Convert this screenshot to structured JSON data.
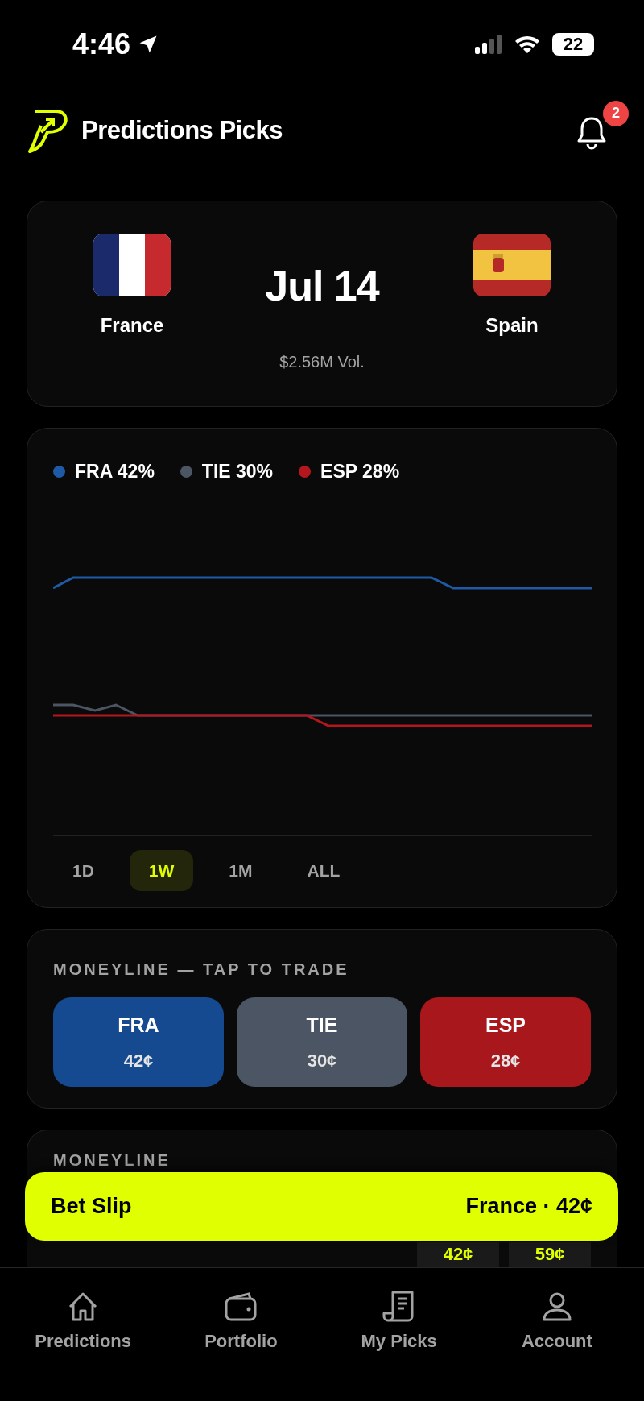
{
  "status_bar": {
    "time": "4:46",
    "battery": "22"
  },
  "header": {
    "title": "Predictions Picks",
    "notification_count": "2"
  },
  "match": {
    "date": "Jul 14",
    "volume": "$2.56M Vol.",
    "teams": [
      {
        "name": "France",
        "kind": "france"
      },
      {
        "name": "Spain",
        "kind": "spain"
      }
    ]
  },
  "chart": {
    "legend": [
      {
        "label": "FRA 42%",
        "color": "#1f5aa6"
      },
      {
        "label": "TIE 30%",
        "color": "#4b5563"
      },
      {
        "label": "ESP 28%",
        "color": "#b3161d"
      }
    ],
    "ranges": [
      {
        "label": "1D",
        "selected": false
      },
      {
        "label": "1W",
        "selected": true
      },
      {
        "label": "1M",
        "selected": false
      },
      {
        "label": "ALL",
        "selected": false
      }
    ]
  },
  "moneyline": {
    "title": "MONEYLINE — TAP TO TRADE",
    "options": [
      {
        "code": "FRA",
        "price": "42¢",
        "color": "#154a91"
      },
      {
        "code": "TIE",
        "price": "30¢",
        "color": "#4b5563"
      },
      {
        "code": "ESP",
        "price": "28¢",
        "color": "#a8171c"
      }
    ]
  },
  "moneyline_list": {
    "title": "MONEYLINE",
    "prices": [
      "42¢",
      "59¢"
    ]
  },
  "bet_slip": {
    "title": "Bet Slip",
    "summary": "France · 42¢"
  },
  "tabs": [
    {
      "label": "Predictions",
      "kind": "home"
    },
    {
      "label": "Portfolio",
      "kind": "wallet"
    },
    {
      "label": "My Picks",
      "kind": "receipt"
    },
    {
      "label": "Account",
      "kind": "person"
    }
  ]
}
